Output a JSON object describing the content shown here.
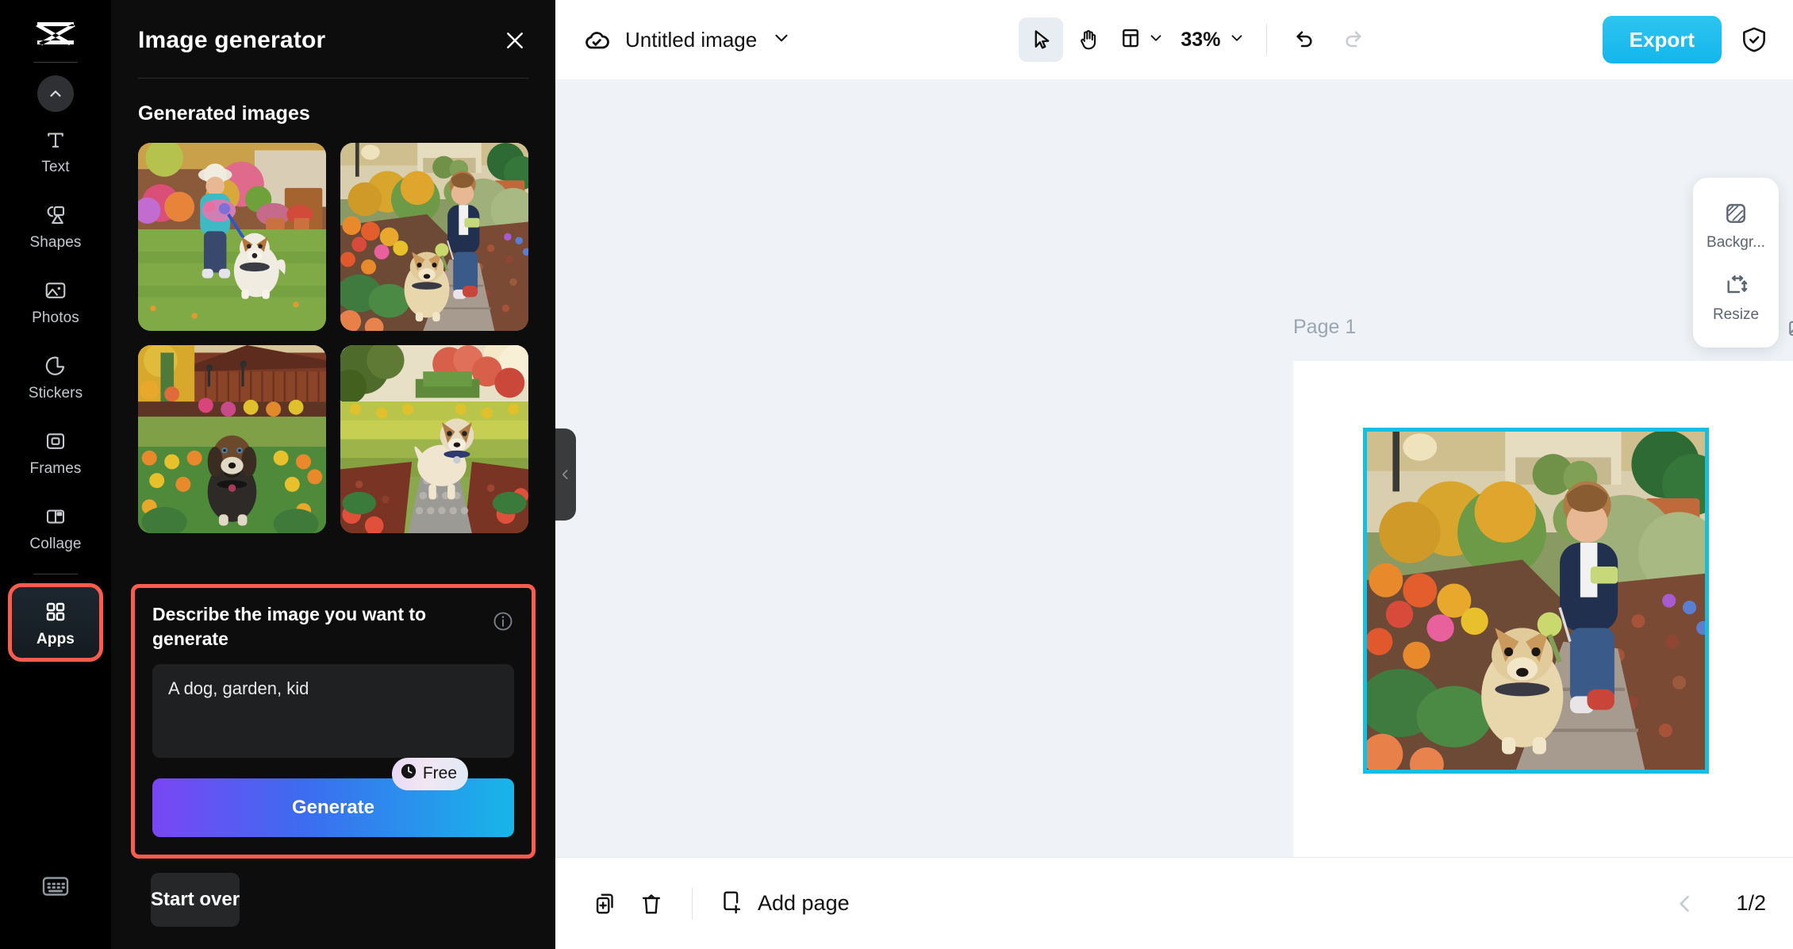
{
  "brand": {
    "logo_name": "capcut-logo"
  },
  "rail": {
    "scroll_up_icon": "chevron-up-icon",
    "items": [
      {
        "label": "Text",
        "icon": "text-icon"
      },
      {
        "label": "Shapes",
        "icon": "shapes-icon"
      },
      {
        "label": "Photos",
        "icon": "photos-icon"
      },
      {
        "label": "Stickers",
        "icon": "stickers-icon"
      },
      {
        "label": "Frames",
        "icon": "frames-icon"
      },
      {
        "label": "Collage",
        "icon": "collage-icon"
      },
      {
        "label": "Apps",
        "icon": "apps-icon"
      }
    ],
    "bottom_icon": "keyboard-icon"
  },
  "panel": {
    "title": "Image generator",
    "close_icon": "close-icon",
    "section_title": "Generated images",
    "thumbnails": [
      {
        "alt": "kid in white hat with flowers walking a dog on green lawn"
      },
      {
        "alt": "boy in navy jacket walking a fluffy dog on a garden path"
      },
      {
        "alt": "black and tan puppy sitting among orange marigolds"
      },
      {
        "alt": "tan and white dog standing on a cobbled garden path"
      }
    ],
    "prompt": {
      "label": "Describe the image you want to generate",
      "info_icon": "info-icon",
      "value": "A dog, garden, kid",
      "placeholder": "Describe the image you want to generate"
    },
    "generate_label": "Generate",
    "free_badge": {
      "label": "Free",
      "icon": "clock-icon"
    },
    "start_over_label": "Start over",
    "collapse_icon": "chevron-left-icon"
  },
  "topbar": {
    "cloud_icon": "cloud-saved-icon",
    "doc_title": "Untitled image",
    "title_caret_icon": "chevron-down-icon",
    "tools": [
      {
        "name": "select-tool",
        "icon": "cursor-icon",
        "selected": true
      },
      {
        "name": "hand-tool",
        "icon": "hand-icon",
        "selected": false
      }
    ],
    "layout_icon": "layout-icon",
    "layout_caret_icon": "chevron-down-icon",
    "zoom_value": "33%",
    "zoom_caret_icon": "chevron-down-icon",
    "undo_icon": "undo-icon",
    "redo_icon": "redo-icon",
    "export_label": "Export",
    "shield_icon": "shield-check-icon"
  },
  "canvas": {
    "page_label": "Page 1",
    "page_copy_icon": "duplicate-image-icon",
    "page_more_icon": "more-horizontal-icon",
    "selected_image_alt": "boy in navy jacket walking a fluffy dog on a garden path",
    "selection_color": "#16bfe0"
  },
  "float_panel": {
    "items": [
      {
        "label": "Backgr...",
        "icon": "background-icon"
      },
      {
        "label": "Resize",
        "icon": "resize-icon"
      }
    ]
  },
  "bottombar": {
    "duplicate_icon": "duplicate-page-icon",
    "delete_icon": "trash-icon",
    "add_page_label": "Add page",
    "add_page_icon": "add-page-icon",
    "prev_icon": "chevron-left-icon",
    "page_count": "1/2"
  },
  "colors": {
    "accent_red": "#fc5c4e",
    "accent_cyan": "#13b6ec",
    "panel_bg": "#0d0d0e",
    "canvas_bg": "#eff3f7"
  }
}
